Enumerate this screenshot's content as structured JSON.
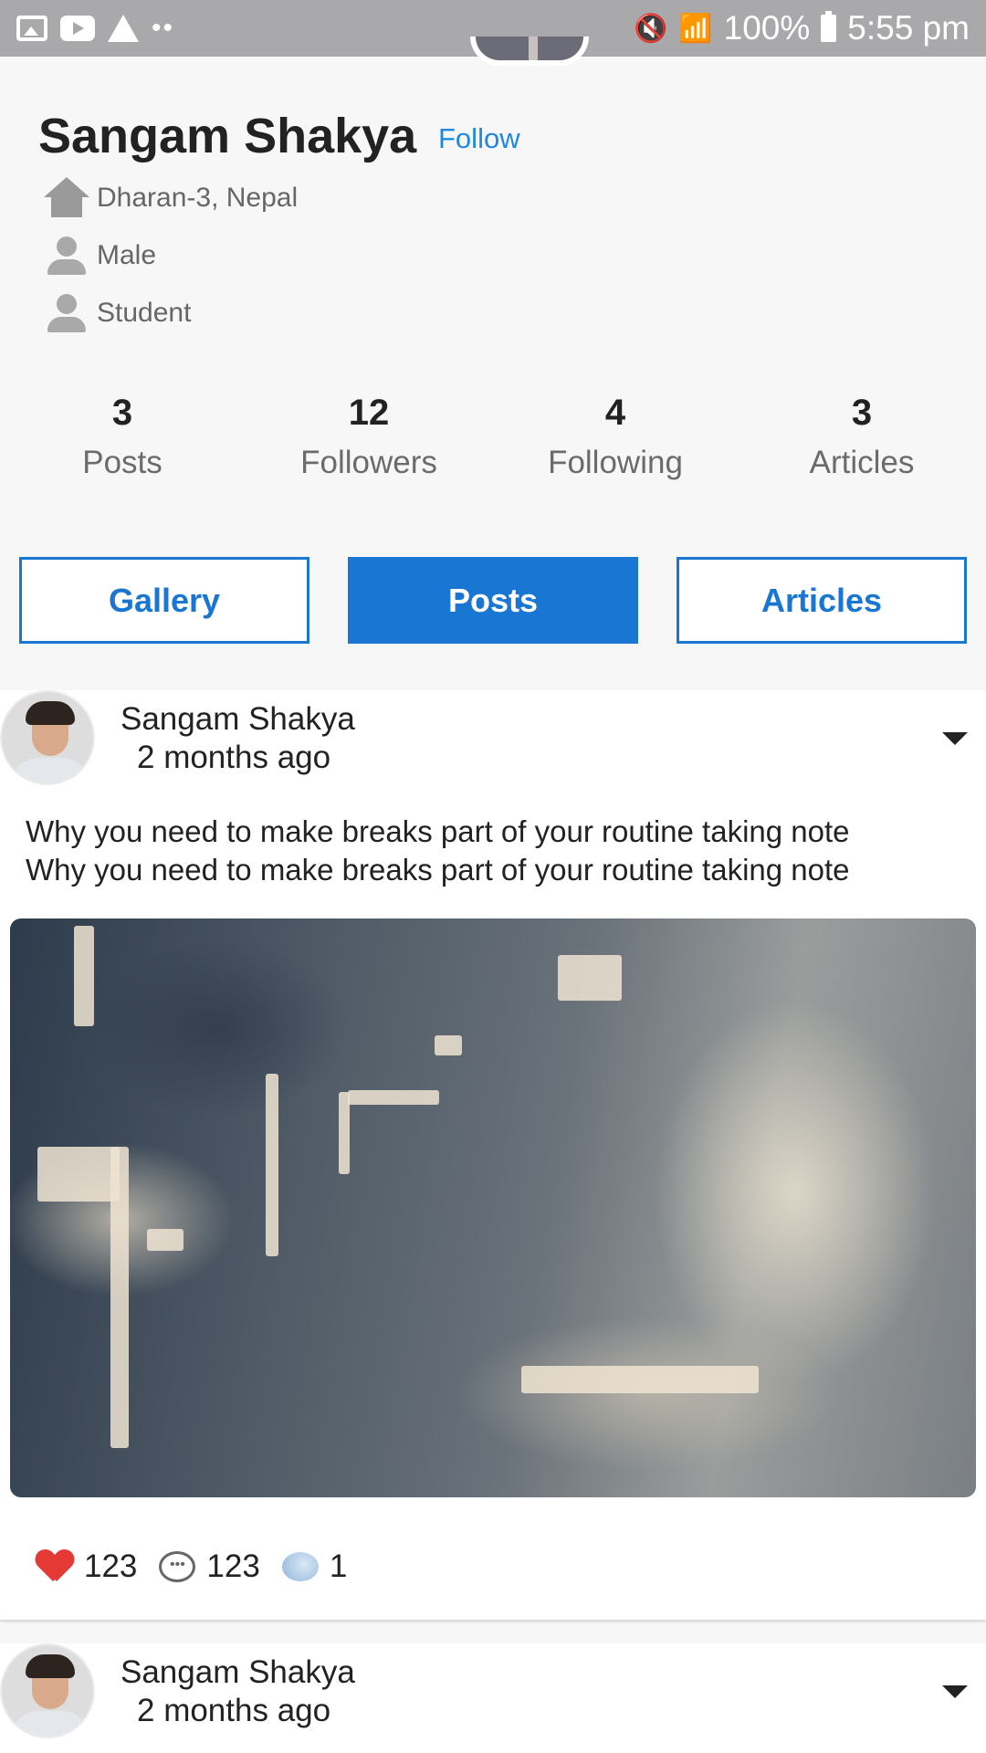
{
  "status_bar": {
    "battery": "100%",
    "time": "5:55 pm",
    "left_icons": [
      "gallery-icon",
      "youtube-icon",
      "warning-icon",
      "more-dots-icon"
    ],
    "right_icons": [
      "mute-icon",
      "wifi-icon",
      "signal-icon",
      "battery-icon"
    ]
  },
  "profile": {
    "name": "Sangam Shakya",
    "follow_label": "Follow",
    "address": "Dharan-3, Nepal",
    "gender": "Male",
    "occupation": "Student"
  },
  "stats": [
    {
      "value": "3",
      "label": "Posts"
    },
    {
      "value": "12",
      "label": "Followers"
    },
    {
      "value": "4",
      "label": "Following"
    },
    {
      "value": "3",
      "label": "Articles"
    }
  ],
  "tabs": [
    {
      "label": "Gallery",
      "active": false
    },
    {
      "label": "Posts",
      "active": true
    },
    {
      "label": "Articles",
      "active": false
    }
  ],
  "posts": [
    {
      "author": "Sangam Shakya",
      "time": "2 months ago",
      "text_line1": "Why you need to make breaks part of your routine taking note",
      "text_line2": "Why you need to make breaks part of your routine taking note",
      "likes": "123",
      "comments": "123",
      "shares": "1"
    },
    {
      "author": "Sangam Shakya",
      "time": "2 months ago"
    }
  ]
}
